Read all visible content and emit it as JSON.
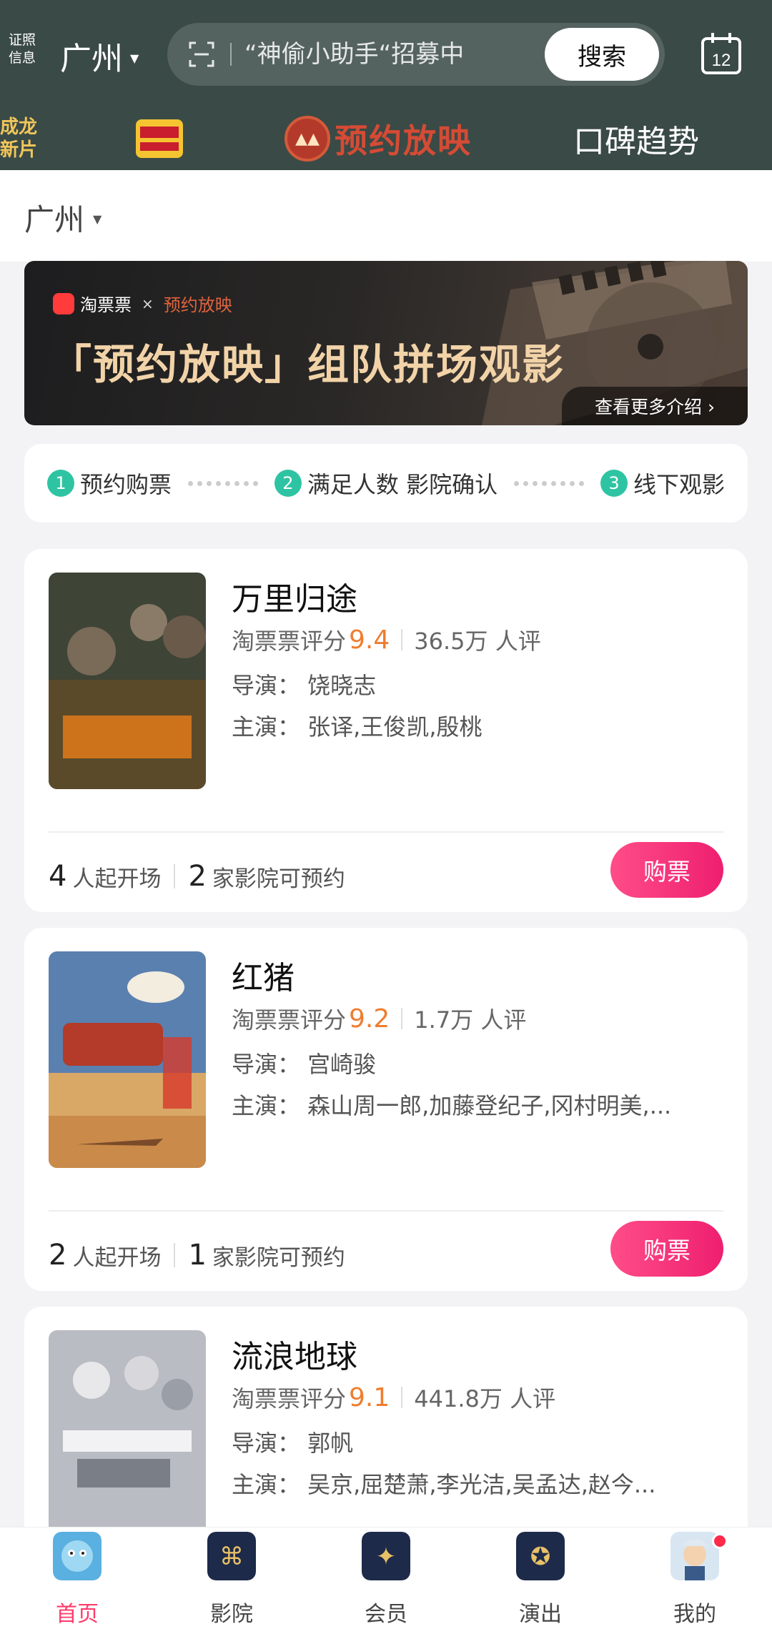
{
  "header": {
    "cert_info": "证照信息",
    "city": "广州",
    "search_placeholder": "“神偷小助手“招募中",
    "search_button": "搜索",
    "calendar_day": "12",
    "nav": {
      "item1": "成龙新片",
      "item3_label": "预约放映",
      "item4": "口碑趋势"
    }
  },
  "citybar": {
    "city": "广州"
  },
  "banner": {
    "brand1": "淘票票",
    "x": "×",
    "brand2": "预约放映",
    "headline": "「预约放映」组队拼场观影",
    "more": "查看更多介绍 ›"
  },
  "steps": [
    {
      "num": "1",
      "label": "预约购票"
    },
    {
      "num": "2",
      "label": "满足人数 影院确认"
    },
    {
      "num": "3",
      "label": "线下观影"
    }
  ],
  "movies": [
    {
      "title": "万里归途",
      "rating_label": "淘票票评分",
      "score": "9.4",
      "reviews": "36.5万 人评",
      "director": "导演：  饶晓志",
      "cast": "主演：  张译,王俊凯,殷桃",
      "min_people": "4",
      "min_people_text": "人起开场",
      "cinemas": "2",
      "cinemas_text": "家影院可预约",
      "buy": "购票"
    },
    {
      "title": "红猪",
      "rating_label": "淘票票评分",
      "score": "9.2",
      "reviews": "1.7万 人评",
      "director": "导演：  宫崎骏",
      "cast": "主演：  森山周一郎,加藤登纪子,冈村明美,...",
      "min_people": "2",
      "min_people_text": "人起开场",
      "cinemas": "1",
      "cinemas_text": "家影院可预约",
      "buy": "购票"
    },
    {
      "title": "流浪地球",
      "rating_label": "淘票票评分",
      "score": "9.1",
      "reviews": "441.8万 人评",
      "director": "导演：  郭帆",
      "cast": "主演：  吴京,屈楚萧,李光洁,吴孟达,赵今...",
      "min_people": "",
      "min_people_text": "",
      "cinemas": "",
      "cinemas_text": "",
      "buy": ""
    }
  ],
  "tabs": [
    {
      "label": "首页",
      "active": true
    },
    {
      "label": "影院"
    },
    {
      "label": "会员"
    },
    {
      "label": "演出"
    },
    {
      "label": "我的"
    }
  ],
  "colors": {
    "header_bg": "#3a4a46",
    "accent_pink": "#ff3b6b",
    "score_orange": "#ef7d2e",
    "step_green": "#2ec4a3"
  }
}
